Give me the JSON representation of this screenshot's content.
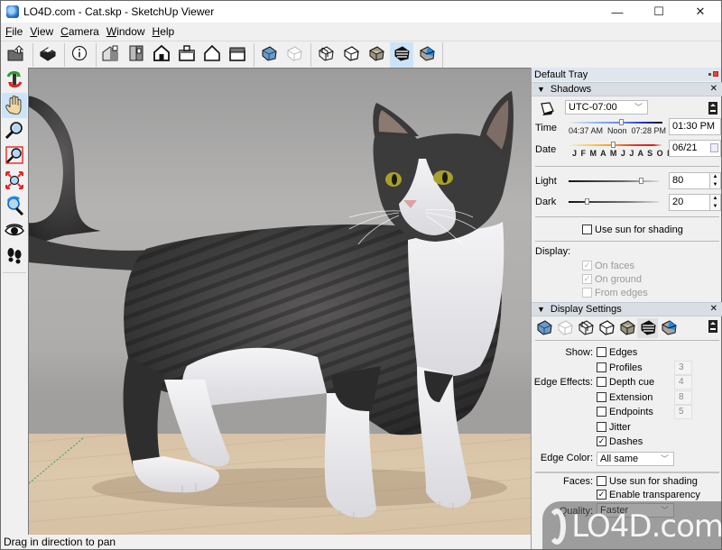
{
  "window": {
    "title": "LO4D.com - Cat.skp - SketchUp Viewer",
    "controls": {
      "minimize": "—",
      "maximize": "☐",
      "close": "✕"
    }
  },
  "menu": [
    {
      "label": "File",
      "mnemonic": "F"
    },
    {
      "label": "View",
      "mnemonic": "V"
    },
    {
      "label": "Camera",
      "mnemonic": "C"
    },
    {
      "label": "Window",
      "mnemonic": "W"
    },
    {
      "label": "Help",
      "mnemonic": "H"
    }
  ],
  "toolbar": {
    "groups": [
      [
        "open-icon"
      ],
      [
        "print-icon"
      ],
      [
        "info-icon"
      ],
      [
        "iso-view-icon",
        "top-view-icon",
        "front-view-icon",
        "right-view-icon",
        "back-view-icon",
        "left-view-icon"
      ],
      [
        "xray-style-icon",
        "back-edges-style-icon"
      ],
      [
        "wireframe-style-icon",
        "hidden-line-style-icon",
        "shaded-style-icon",
        "shaded-textures-style-icon",
        "monochrome-style-icon"
      ]
    ],
    "active": "shaded-textures-style-icon"
  },
  "left_tools": [
    {
      "name": "orbit-icon"
    },
    {
      "name": "pan-icon",
      "active": true
    },
    {
      "name": "zoom-icon"
    },
    {
      "name": "zoom-window-icon"
    },
    {
      "name": "zoom-extents-icon"
    },
    {
      "name": "previous-view-icon"
    },
    {
      "name": "look-around-icon"
    },
    {
      "name": "walk-icon"
    }
  ],
  "status": {
    "text": "Drag in direction to pan"
  },
  "tray": {
    "title": "Default Tray",
    "shadows": {
      "header": "Shadows",
      "timezone": "UTC-07:00",
      "time_label": "Time",
      "time_marks": [
        "04:37 AM",
        "Noon",
        "07:28 PM"
      ],
      "time_value": "01:30 PM",
      "time_fraction": 0.56,
      "date_label": "Date",
      "months": "J F M A M J J A S O N D",
      "date_value": "06/21",
      "date_fraction": 0.47,
      "light_label": "Light",
      "light_value": "80",
      "dark_label": "Dark",
      "dark_value": "20",
      "use_sun_label": "Use sun for shading",
      "use_sun_checked": false,
      "display_label": "Display:",
      "display_options": [
        {
          "label": "On faces",
          "checked": true,
          "disabled": true
        },
        {
          "label": "On ground",
          "checked": true,
          "disabled": true
        },
        {
          "label": "From edges",
          "checked": false,
          "disabled": true
        }
      ]
    },
    "display_settings": {
      "header": "Display Settings",
      "styles": [
        "xray-style-icon",
        "back-edges-style-icon",
        "wireframe-style-icon",
        "hidden-line-style-icon",
        "shaded-style-icon",
        "shaded-textures-style-icon",
        "monochrome-style-icon"
      ],
      "active_style": "shaded-textures-style-icon",
      "show_label": "Show:",
      "edge_effects_label": "Edge Effects:",
      "edges": [
        {
          "label": "Edges",
          "checked": false,
          "value": ""
        },
        {
          "label": "Profiles",
          "checked": false,
          "value": "3"
        },
        {
          "label": "Depth cue",
          "checked": false,
          "value": "4"
        },
        {
          "label": "Extension",
          "checked": false,
          "value": "8"
        },
        {
          "label": "Endpoints",
          "checked": false,
          "value": "5"
        },
        {
          "label": "Jitter",
          "checked": false,
          "value": ""
        },
        {
          "label": "Dashes",
          "checked": true,
          "value": ""
        }
      ],
      "edge_color_label": "Edge Color:",
      "edge_color_value": "All same",
      "faces_label": "Faces:",
      "faces_options": [
        {
          "label": "Use sun for shading",
          "checked": false
        },
        {
          "label": "Enable transparency",
          "checked": true
        }
      ],
      "quality_label": "Quality:",
      "quality_value": "Faster"
    }
  },
  "watermark": {
    "text": "LO4D.com"
  }
}
